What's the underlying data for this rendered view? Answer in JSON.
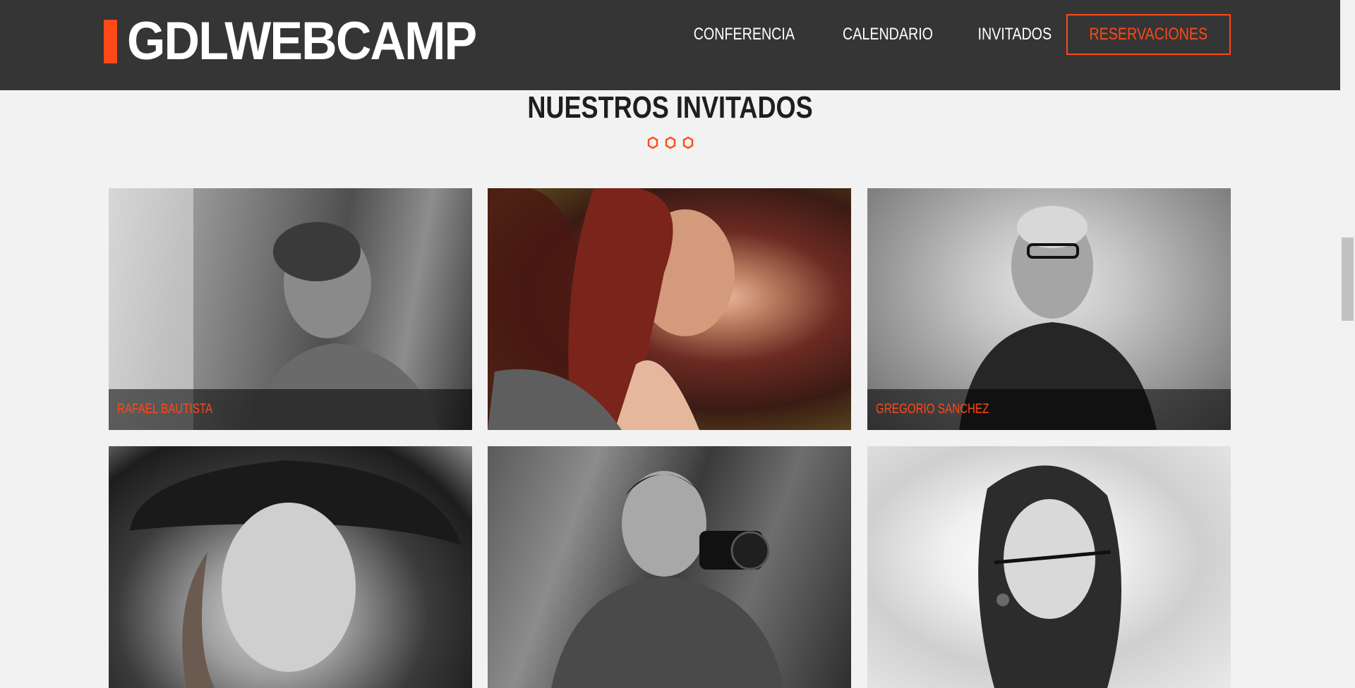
{
  "header": {
    "logo_text": "GDLWEBCAMP",
    "nav": [
      {
        "label": "CONFERENCIA"
      },
      {
        "label": "CALENDARIO"
      },
      {
        "label": "INVITADOS"
      },
      {
        "label": "RESERVACIONES"
      }
    ]
  },
  "section": {
    "title": "NUESTROS INVITADOS"
  },
  "guests": [
    {
      "name": "RAFAEL BAUTISTA"
    },
    {
      "name": ""
    },
    {
      "name": "GREGORIO SANCHEZ"
    },
    {
      "name": ""
    },
    {
      "name": ""
    },
    {
      "name": ""
    }
  ],
  "colors": {
    "accent": "#fe4918",
    "header_bg": "#353535",
    "page_bg": "#f2f2f2"
  }
}
